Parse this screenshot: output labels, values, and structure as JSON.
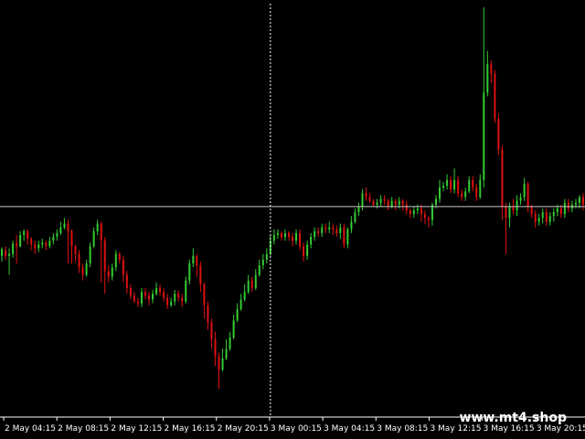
{
  "chart_data": {
    "type": "candlestick",
    "colors": {
      "background": "#000000",
      "bull": "#33cc33",
      "bear": "#dd1111",
      "crosshair": "#ffffff",
      "price_line": "#c8c8c8",
      "text": "#ffffff"
    },
    "x_tick_labels": [
      "2 May 04:15",
      "2 May 08:15",
      "2 May 12:15",
      "2 May 16:15",
      "2 May 20:15",
      "3 May 00:15",
      "3 May 04:15",
      "3 May 08:15",
      "3 May 12:15",
      "3 May 16:15",
      "3 May 20:15"
    ],
    "candles": [
      [
        0,
        292,
        285,
        298,
        283
      ],
      [
        1,
        286,
        292,
        296,
        282
      ],
      [
        2,
        292,
        290,
        312,
        284
      ],
      [
        3,
        290,
        279,
        294,
        276
      ],
      [
        4,
        279,
        282,
        300,
        270
      ],
      [
        5,
        282,
        270,
        283,
        266
      ],
      [
        6,
        270,
        266,
        276,
        264
      ],
      [
        7,
        266,
        274,
        280,
        264
      ],
      [
        8,
        274,
        280,
        286,
        272
      ],
      [
        9,
        280,
        284,
        290,
        276
      ],
      [
        10,
        284,
        280,
        288,
        276
      ],
      [
        11,
        280,
        278,
        284,
        274
      ],
      [
        12,
        278,
        282,
        286,
        276
      ],
      [
        13,
        282,
        276,
        284,
        272
      ],
      [
        14,
        276,
        272,
        280,
        268
      ],
      [
        15,
        272,
        268,
        276,
        264
      ],
      [
        16,
        268,
        262,
        270,
        256
      ],
      [
        17,
        262,
        258,
        264,
        252
      ],
      [
        18,
        258,
        266,
        300,
        254
      ],
      [
        19,
        266,
        282,
        300,
        264
      ],
      [
        20,
        282,
        290,
        298,
        280
      ],
      [
        21,
        290,
        304,
        310,
        286
      ],
      [
        22,
        304,
        312,
        318,
        300
      ],
      [
        23,
        312,
        300,
        314,
        296
      ],
      [
        24,
        300,
        282,
        304,
        278
      ],
      [
        25,
        282,
        266,
        284,
        262
      ],
      [
        26,
        266,
        258,
        270,
        254
      ],
      [
        27,
        258,
        276,
        320,
        256
      ],
      [
        28,
        276,
        308,
        332,
        272
      ],
      [
        29,
        308,
        314,
        320,
        302
      ],
      [
        30,
        314,
        304,
        318,
        300
      ],
      [
        31,
        304,
        290,
        308,
        286
      ],
      [
        32,
        290,
        296,
        300,
        288
      ],
      [
        33,
        296,
        312,
        320,
        292
      ],
      [
        34,
        312,
        326,
        332,
        308
      ],
      [
        35,
        326,
        334,
        338,
        322
      ],
      [
        36,
        334,
        340,
        342,
        330
      ],
      [
        37,
        340,
        342,
        346,
        336
      ],
      [
        38,
        342,
        330,
        346,
        326
      ],
      [
        39,
        330,
        334,
        338,
        326
      ],
      [
        40,
        334,
        338,
        344,
        330
      ],
      [
        41,
        338,
        332,
        342,
        328
      ],
      [
        42,
        332,
        326,
        334,
        320
      ],
      [
        43,
        326,
        330,
        334,
        322
      ],
      [
        44,
        330,
        336,
        340,
        326
      ],
      [
        45,
        336,
        344,
        348,
        332
      ],
      [
        46,
        344,
        340,
        346,
        336
      ],
      [
        47,
        340,
        332,
        344,
        328
      ],
      [
        48,
        332,
        336,
        340,
        328
      ],
      [
        49,
        336,
        340,
        346,
        332
      ],
      [
        50,
        340,
        318,
        342,
        314
      ],
      [
        51,
        318,
        300,
        322,
        296
      ],
      [
        52,
        300,
        292,
        304,
        284
      ],
      [
        53,
        292,
        302,
        314,
        290
      ],
      [
        54,
        302,
        322,
        330,
        298
      ],
      [
        55,
        322,
        344,
        358,
        320
      ],
      [
        56,
        344,
        362,
        370,
        340
      ],
      [
        57,
        362,
        380,
        390,
        358
      ],
      [
        58,
        380,
        398,
        408,
        372
      ],
      [
        59,
        398,
        412,
        432,
        394
      ],
      [
        60,
        412,
        400,
        414,
        390
      ],
      [
        61,
        400,
        390,
        402,
        380
      ],
      [
        62,
        390,
        378,
        392,
        372
      ],
      [
        63,
        378,
        360,
        380,
        354
      ],
      [
        64,
        360,
        348,
        362,
        342
      ],
      [
        65,
        348,
        338,
        350,
        332
      ],
      [
        66,
        338,
        330,
        340,
        322
      ],
      [
        67,
        330,
        318,
        332,
        312
      ],
      [
        68,
        318,
        326,
        330,
        314
      ],
      [
        69,
        326,
        312,
        328,
        306
      ],
      [
        70,
        312,
        302,
        314,
        296
      ],
      [
        71,
        302,
        296,
        306,
        290
      ],
      [
        72,
        296,
        290,
        300,
        284
      ],
      [
        73,
        290,
        276,
        292,
        270
      ],
      [
        74,
        276,
        270,
        280,
        264
      ],
      [
        75,
        270,
        268,
        274,
        264
      ],
      [
        76,
        268,
        272,
        276,
        266
      ],
      [
        77,
        272,
        268,
        276,
        264
      ],
      [
        78,
        268,
        272,
        276,
        266
      ],
      [
        79,
        272,
        276,
        282,
        268
      ],
      [
        80,
        276,
        268,
        280,
        264
      ],
      [
        81,
        268,
        282,
        286,
        264
      ],
      [
        82,
        282,
        292,
        298,
        278
      ],
      [
        83,
        292,
        280,
        296,
        276
      ],
      [
        84,
        280,
        272,
        284,
        268
      ],
      [
        85,
        272,
        266,
        276,
        262
      ],
      [
        86,
        266,
        268,
        272,
        262
      ],
      [
        87,
        268,
        262,
        272,
        258
      ],
      [
        88,
        262,
        264,
        268,
        258
      ],
      [
        89,
        264,
        262,
        268,
        256
      ],
      [
        90,
        262,
        264,
        270,
        258
      ],
      [
        91,
        264,
        268,
        272,
        260
      ],
      [
        92,
        268,
        262,
        274,
        258
      ],
      [
        93,
        262,
        280,
        284,
        258
      ],
      [
        94,
        280,
        264,
        284,
        262
      ],
      [
        95,
        264,
        256,
        268,
        250
      ],
      [
        96,
        256,
        246,
        258,
        242
      ],
      [
        97,
        246,
        240,
        250,
        236
      ],
      [
        98,
        240,
        226,
        244,
        222
      ],
      [
        99,
        226,
        230,
        234,
        220
      ],
      [
        100,
        230,
        234,
        236,
        226
      ],
      [
        101,
        234,
        238,
        240,
        232
      ],
      [
        102,
        238,
        236,
        242,
        232
      ],
      [
        103,
        236,
        232,
        240,
        228
      ],
      [
        104,
        232,
        234,
        238,
        228
      ],
      [
        105,
        234,
        240,
        244,
        232
      ],
      [
        106,
        240,
        234,
        242,
        230
      ],
      [
        107,
        234,
        238,
        244,
        232
      ],
      [
        108,
        238,
        234,
        242,
        230
      ],
      [
        109,
        234,
        238,
        244,
        232
      ],
      [
        110,
        238,
        244,
        248,
        234
      ],
      [
        111,
        244,
        248,
        252,
        242
      ],
      [
        112,
        248,
        244,
        252,
        240
      ],
      [
        113,
        244,
        242,
        248,
        238
      ],
      [
        114,
        242,
        248,
        256,
        238
      ],
      [
        115,
        248,
        252,
        258,
        244
      ],
      [
        116,
        252,
        254,
        262,
        250
      ],
      [
        117,
        254,
        238,
        260,
        236
      ],
      [
        118,
        238,
        232,
        242,
        228
      ],
      [
        119,
        232,
        220,
        236,
        212
      ],
      [
        120,
        220,
        218,
        224,
        214
      ],
      [
        121,
        218,
        212,
        222,
        206
      ],
      [
        122,
        212,
        222,
        226,
        208
      ],
      [
        123,
        222,
        212,
        226,
        200
      ],
      [
        124,
        212,
        226,
        230,
        208
      ],
      [
        125,
        226,
        230,
        234,
        222
      ],
      [
        126,
        230,
        224,
        234,
        220
      ],
      [
        127,
        224,
        212,
        226,
        208
      ],
      [
        128,
        212,
        220,
        224,
        208
      ],
      [
        129,
        220,
        230,
        234,
        216
      ],
      [
        130,
        230,
        212,
        232,
        206
      ],
      [
        131,
        212,
        120,
        220,
        30
      ],
      [
        132,
        120,
        90,
        124,
        76
      ],
      [
        133,
        90,
        100,
        110,
        86
      ],
      [
        134,
        100,
        148,
        152,
        96
      ],
      [
        135,
        148,
        180,
        186,
        142
      ],
      [
        136,
        180,
        240,
        254,
        176
      ],
      [
        137,
        240,
        252,
        290,
        236
      ],
      [
        138,
        252,
        240,
        262,
        236
      ],
      [
        139,
        240,
        244,
        248,
        232
      ],
      [
        140,
        244,
        234,
        250,
        228
      ],
      [
        141,
        234,
        230,
        238,
        226
      ],
      [
        142,
        230,
        216,
        234,
        210
      ],
      [
        143,
        216,
        240,
        246,
        214
      ],
      [
        144,
        240,
        248,
        252,
        238
      ],
      [
        145,
        248,
        256,
        262,
        244
      ],
      [
        146,
        256,
        252,
        260,
        248
      ],
      [
        147,
        252,
        246,
        258,
        242
      ],
      [
        148,
        246,
        256,
        260,
        242
      ],
      [
        149,
        256,
        250,
        260,
        246
      ],
      [
        150,
        250,
        246,
        256,
        242
      ],
      [
        151,
        246,
        242,
        250,
        238
      ],
      [
        152,
        242,
        248,
        252,
        238
      ],
      [
        153,
        248,
        236,
        252,
        232
      ],
      [
        154,
        236,
        242,
        246,
        232
      ],
      [
        155,
        242,
        238,
        246,
        234
      ],
      [
        156,
        238,
        236,
        242,
        232
      ],
      [
        157,
        236,
        230,
        242,
        228
      ],
      [
        158,
        230,
        238,
        244,
        226
      ]
    ],
    "crosshair": {
      "vertical_at_candle": 73,
      "horizontal_at_value": 240
    },
    "y_range": [
      30,
      432
    ]
  },
  "watermark": "www.mt4.shop"
}
